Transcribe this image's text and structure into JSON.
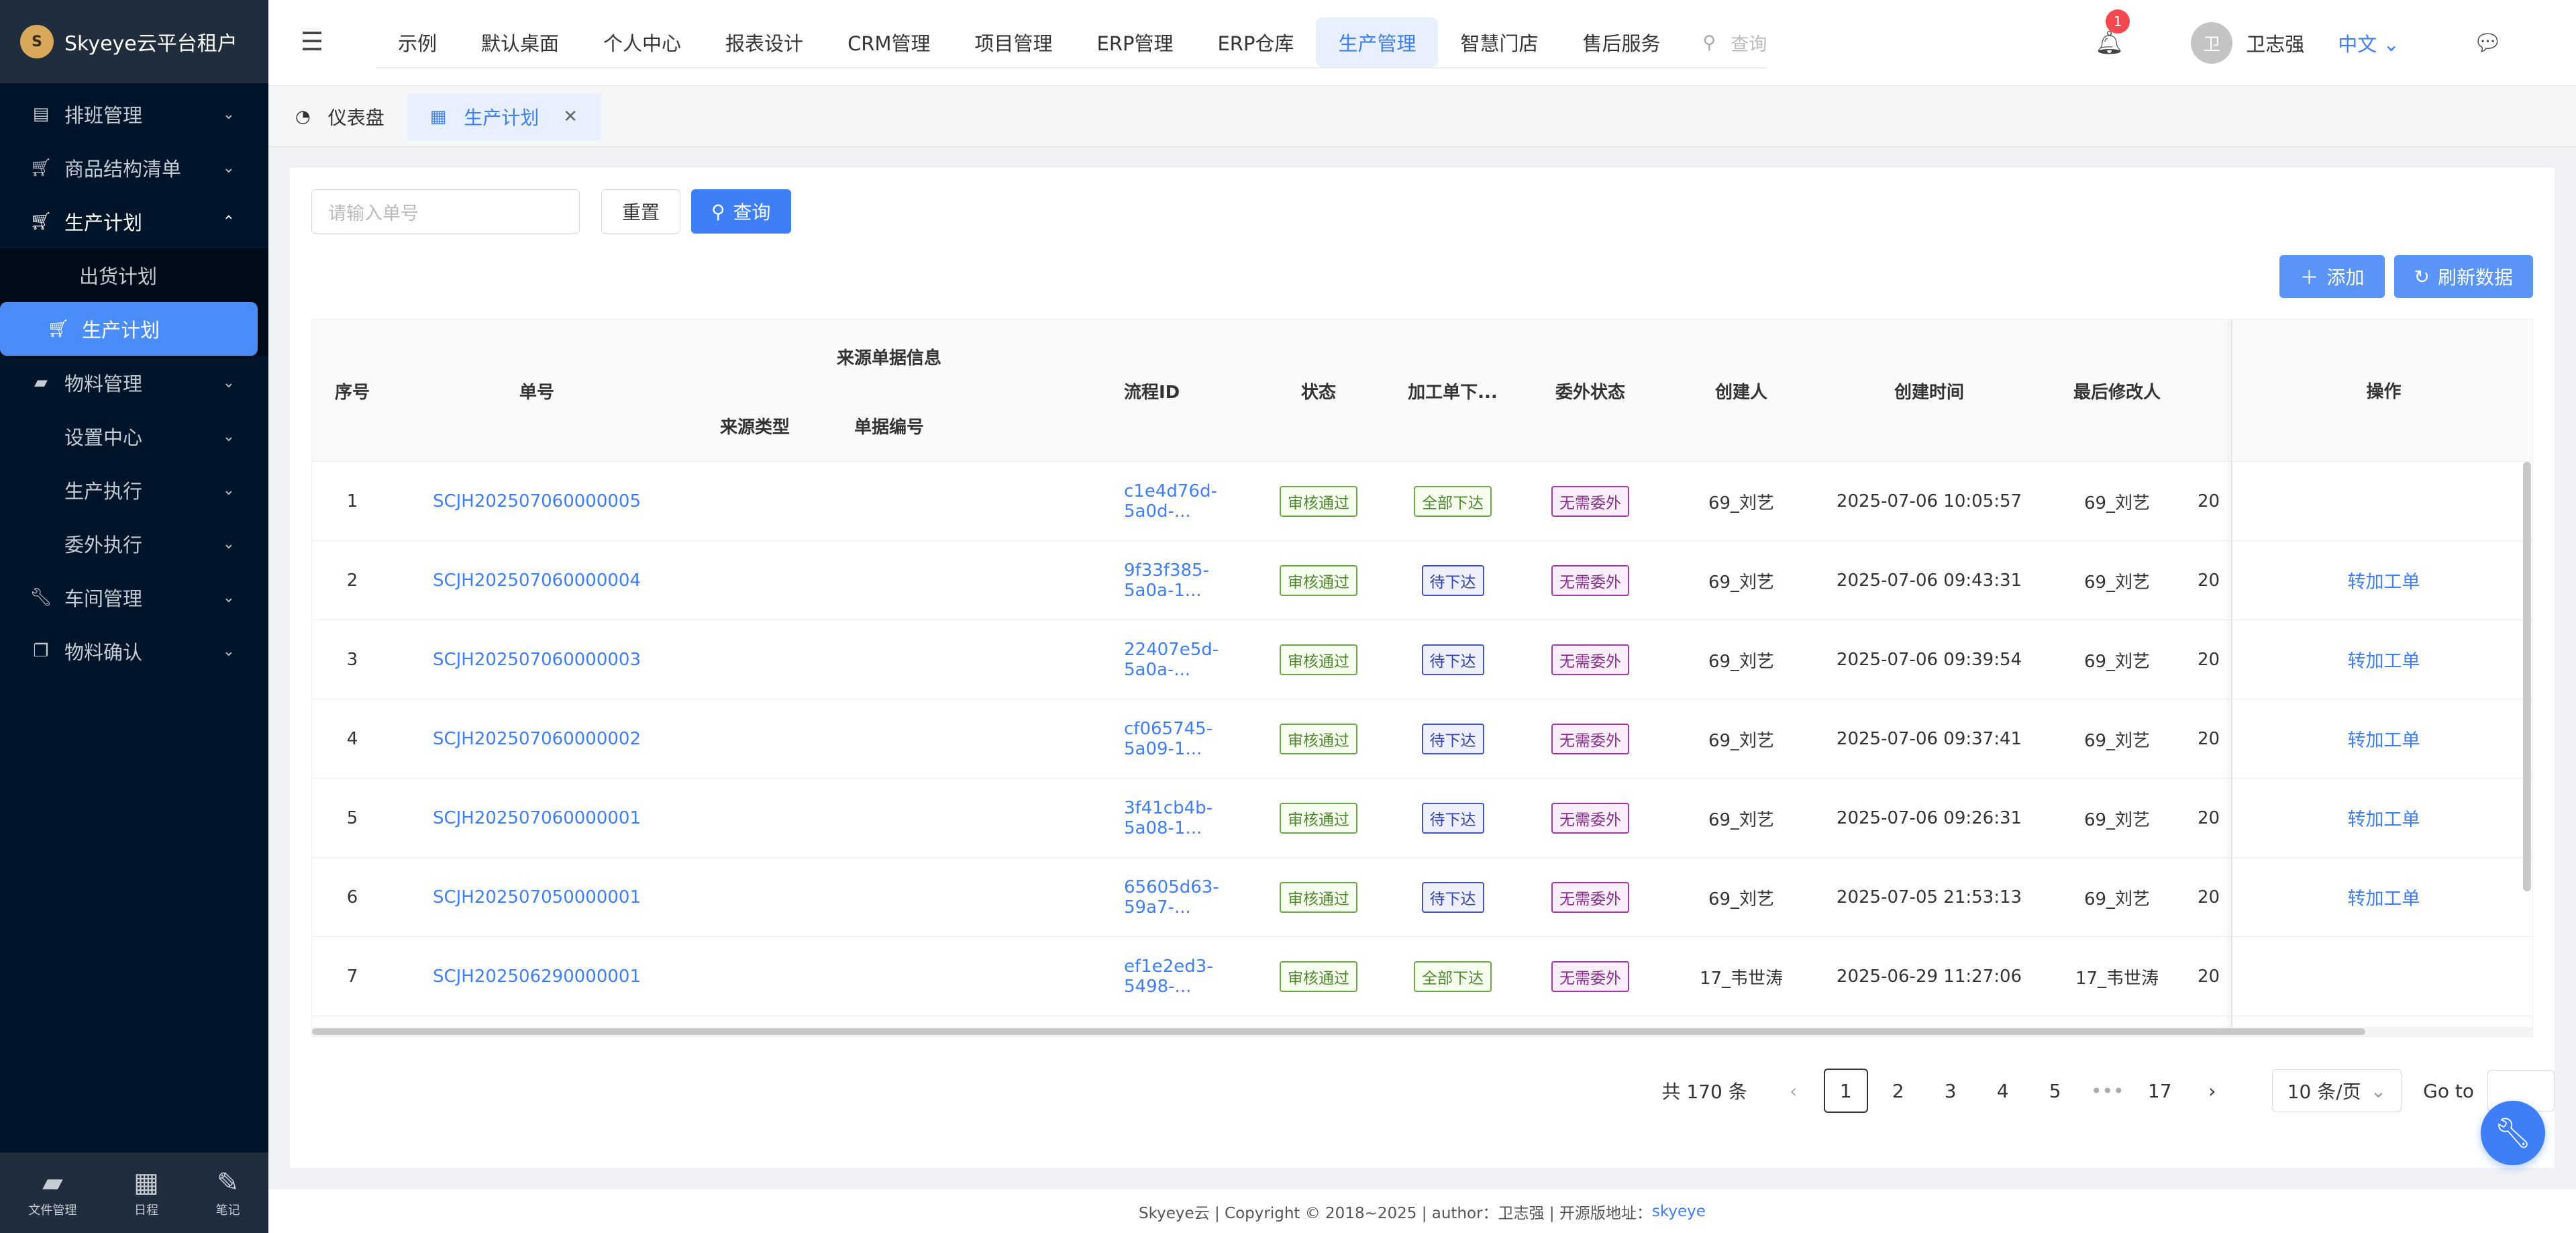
{
  "app": {
    "title": "Skyeye云平台租户",
    "logo_char": "S"
  },
  "sidebar": {
    "items": [
      {
        "label": "排班管理",
        "icon": "calendar-icon"
      },
      {
        "label": "商品结构清单",
        "icon": "cart-icon"
      },
      {
        "label": "生产计划",
        "icon": "cart-icon"
      },
      {
        "label": "出货计划"
      },
      {
        "label": "生产计划",
        "icon": "cart-icon"
      },
      {
        "label": "物料管理",
        "icon": "folder-icon"
      },
      {
        "label": "设置中心"
      },
      {
        "label": "生产执行"
      },
      {
        "label": "委外执行"
      },
      {
        "label": "车间管理",
        "icon": "wrench-icon"
      },
      {
        "label": "物料确认",
        "icon": "copy-icon"
      }
    ],
    "footer": [
      {
        "label": "文件管理",
        "icon": "folder-icon"
      },
      {
        "label": "日程",
        "icon": "calendar-icon"
      },
      {
        "label": "笔记",
        "icon": "edit-icon"
      }
    ]
  },
  "topnav": {
    "items": [
      "示例",
      "默认桌面",
      "个人中心",
      "报表设计",
      "CRM管理",
      "项目管理",
      "ERP管理",
      "ERP仓库",
      "生产管理",
      "智慧门店",
      "售后服务"
    ],
    "selected": "生产管理",
    "search_placeholder": "查询"
  },
  "user": {
    "notifications": "1",
    "avatar_char": "卫",
    "name": "卫志强",
    "language": "中文"
  },
  "tabs": [
    {
      "label": "仪表盘",
      "icon": "dashboard-icon"
    },
    {
      "label": "生产计划",
      "icon": "grid-icon"
    }
  ],
  "filter": {
    "placeholder": "请输入单号",
    "reset": "重置",
    "query": "查询"
  },
  "toolbar": {
    "add": "添加",
    "refresh": "刷新数据"
  },
  "table": {
    "headers": {
      "index": "序号",
      "number": "单号",
      "source_group": "来源单据信息",
      "source_type": "来源类型",
      "source_no": "单据编号",
      "flow_id": "流程ID",
      "status": "状态",
      "issue": "加工单下...",
      "outsource": "委外状态",
      "creator": "创建人",
      "created_at": "创建时间",
      "modifier": "最后修改人",
      "ops": "操作"
    },
    "rows": [
      {
        "idx": "1",
        "no": "SCJH202507060000005",
        "flow": "c1e4d76d-5a0d-...",
        "status": "审核通过",
        "issue": "全部下达",
        "issue_c": "green",
        "out": "无需委外",
        "creator": "69_刘艺",
        "time": "2025-07-06 10:05:57",
        "mod": "69_刘艺",
        "trunc": "20",
        "op": ""
      },
      {
        "idx": "2",
        "no": "SCJH202507060000004",
        "flow": "9f33f385-5a0a-1...",
        "status": "审核通过",
        "issue": "待下达",
        "issue_c": "blue",
        "out": "无需委外",
        "creator": "69_刘艺",
        "time": "2025-07-06 09:43:31",
        "mod": "69_刘艺",
        "trunc": "20",
        "op": "转加工单"
      },
      {
        "idx": "3",
        "no": "SCJH202507060000003",
        "flow": "22407e5d-5a0a-...",
        "status": "审核通过",
        "issue": "待下达",
        "issue_c": "blue",
        "out": "无需委外",
        "creator": "69_刘艺",
        "time": "2025-07-06 09:39:54",
        "mod": "69_刘艺",
        "trunc": "20",
        "op": "转加工单"
      },
      {
        "idx": "4",
        "no": "SCJH202507060000002",
        "flow": "cf065745-5a09-1...",
        "status": "审核通过",
        "issue": "待下达",
        "issue_c": "blue",
        "out": "无需委外",
        "creator": "69_刘艺",
        "time": "2025-07-06 09:37:41",
        "mod": "69_刘艺",
        "trunc": "20",
        "op": "转加工单"
      },
      {
        "idx": "5",
        "no": "SCJH202507060000001",
        "flow": "3f41cb4b-5a08-1...",
        "status": "审核通过",
        "issue": "待下达",
        "issue_c": "blue",
        "out": "无需委外",
        "creator": "69_刘艺",
        "time": "2025-07-06 09:26:31",
        "mod": "69_刘艺",
        "trunc": "20",
        "op": "转加工单"
      },
      {
        "idx": "6",
        "no": "SCJH202507050000001",
        "flow": "65605d63-59a7-...",
        "status": "审核通过",
        "issue": "待下达",
        "issue_c": "blue",
        "out": "无需委外",
        "creator": "69_刘艺",
        "time": "2025-07-05 21:53:13",
        "mod": "69_刘艺",
        "trunc": "20",
        "op": "转加工单"
      },
      {
        "idx": "7",
        "no": "SCJH202506290000001",
        "flow": "ef1e2ed3-5498-...",
        "status": "审核通过",
        "issue": "全部下达",
        "issue_c": "green",
        "out": "无需委外",
        "creator": "17_韦世涛",
        "time": "2025-06-29 11:27:06",
        "mod": "17_韦世涛",
        "trunc": "20",
        "op": ""
      }
    ]
  },
  "pagination": {
    "total": "共 170 条",
    "pages": [
      "1",
      "2",
      "3",
      "4",
      "5"
    ],
    "ellipsis": "•••",
    "last": "17",
    "current": "1",
    "page_size": "10 条/页",
    "goto": "Go to"
  },
  "footer": {
    "text": "Skyeye云 | Copyright © 2018~2025 | author：卫志强 | 开源版地址：",
    "link": "skyeye"
  },
  "colors": {
    "accent": "#3e7ef6",
    "sidebar": "#001529"
  }
}
